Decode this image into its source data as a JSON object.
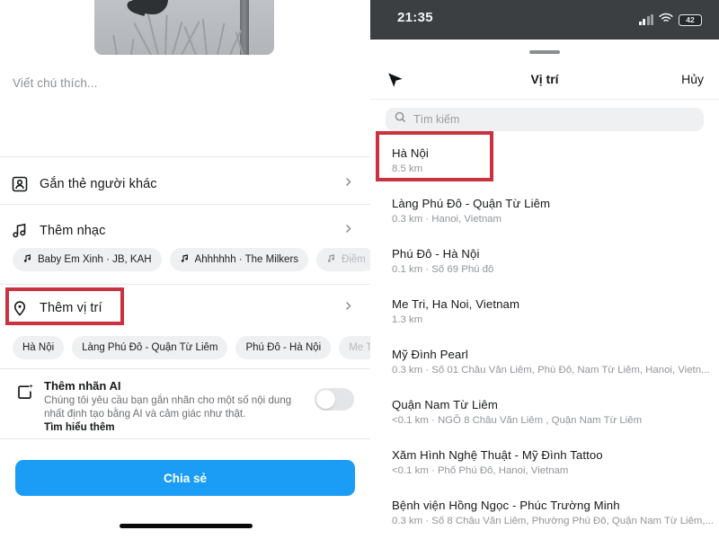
{
  "left": {
    "photo": {
      "alt": "grayscale-photo-bird-on-barbed-wire"
    },
    "caption_placeholder": "Viết chú thích...",
    "options": [
      {
        "icon": "tag-person-icon",
        "label": "Gắn thẻ người khác"
      },
      {
        "icon": "music-note-icon",
        "label": "Thêm nhạc"
      },
      {
        "icon": "location-pin-icon",
        "label": "Thêm vị trí"
      }
    ],
    "music_chips": [
      {
        "label": "Baby Em Xinh · JB, KAH",
        "faded": false
      },
      {
        "label": "Ahhhhhh · The Milkers",
        "faded": false
      },
      {
        "label": "Điềm",
        "faded": true
      }
    ],
    "location_chips": [
      {
        "label": "Hà Nội",
        "faded": false
      },
      {
        "label": "Làng Phú Đô - Quận Từ Liêm",
        "faded": false
      },
      {
        "label": "Phú Đô - Hà Nội",
        "faded": false
      },
      {
        "label": "Me T",
        "faded": true
      }
    ],
    "ai_label": {
      "title": "Thêm nhãn AI",
      "description": "Chúng tôi yêu cầu bạn gắn nhãn cho một số nội dung nhất định tạo bằng AI và cảm giác như thật.",
      "link": "Tìm hiểu thêm",
      "toggle_state": "off"
    },
    "share_button": "Chia sẻ"
  },
  "right": {
    "statusbar": {
      "time": "21:35",
      "battery": "42"
    },
    "nav": {
      "title": "Vị trí",
      "cancel": "Hủy",
      "locate_icon": "navigation-arrow-icon"
    },
    "search": {
      "placeholder": "Tìm kiếm",
      "icon": "search-icon"
    },
    "locations": [
      {
        "name": "Hà Nội",
        "sub": "8.5 km"
      },
      {
        "name": "Làng Phú Đô - Quận Từ Liêm",
        "sub": "0.3 km · Hanoi, Vietnam"
      },
      {
        "name": "Phú Đô - Hà Nội",
        "sub": "0.1 km · Số 69 Phú đô"
      },
      {
        "name": "Me Tri, Ha Noi, Vietnam",
        "sub": "1.3 km"
      },
      {
        "name": "Mỹ Đình Pearl",
        "sub": "0.3 km · Số 01 Châu Văn Liêm, Phú Đô, Nam Từ Liêm, Hanoi, Vietn..."
      },
      {
        "name": "Quận Nam Từ Liêm",
        "sub": "<0.1 km ·  NGÕ 8 Châu Văn Liêm , Quận Nam Từ Liêm"
      },
      {
        "name": "Xăm Hình Nghệ Thuật - Mỹ Đình Tattoo",
        "sub": "<0.1 km · Phố Phú Đô, Hanoi, Vietnam"
      },
      {
        "name": "Bệnh viện Hồng Ngọc - Phúc Trường Minh",
        "sub": "0.3 km · Số 8 Châu Văn Liêm, Phường Phú Đô, Quận Nam Từ Liêm,..."
      }
    ]
  },
  "annotations": {
    "highlight_color": "#c9333f",
    "boxes": [
      {
        "name": "them-vi-tri-highlight"
      },
      {
        "name": "ha-noi-result-highlight"
      }
    ]
  },
  "colors": {
    "accent_blue": "#1b9df5",
    "chip_bg": "#eef0f2",
    "status_bar": "#3c3f42"
  }
}
